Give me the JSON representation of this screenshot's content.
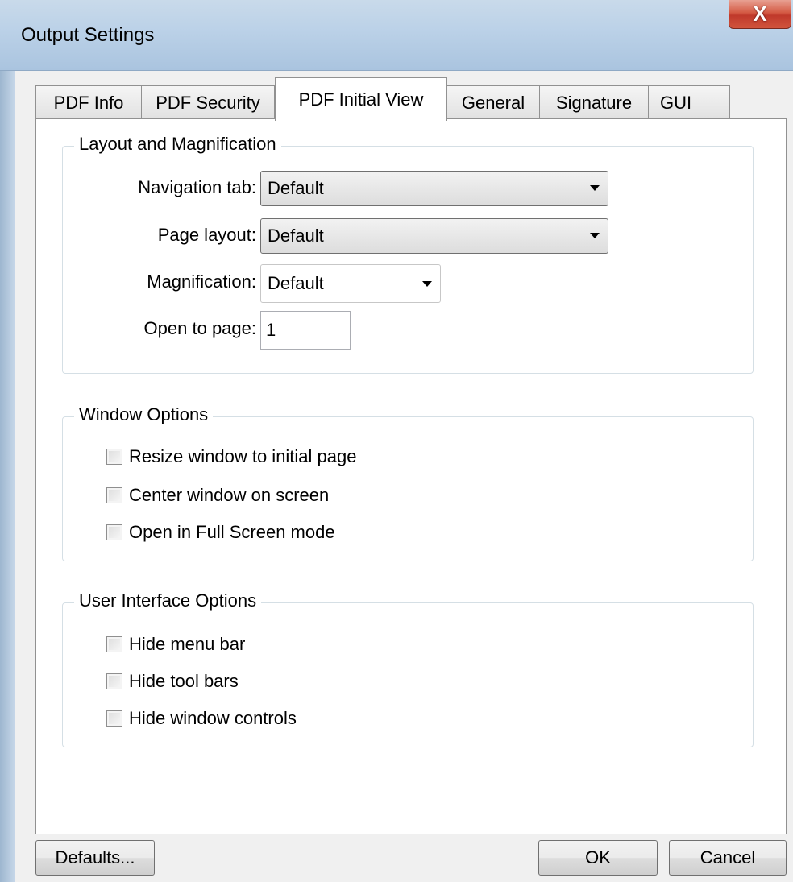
{
  "window": {
    "title": "Output Settings",
    "close_glyph": "X"
  },
  "tabs": [
    {
      "label": "PDF Info"
    },
    {
      "label": "PDF Security"
    },
    {
      "label": "PDF Initial View",
      "active": true
    },
    {
      "label": "General"
    },
    {
      "label": "Signature"
    },
    {
      "label": "GUI"
    }
  ],
  "layout_group": {
    "title": "Layout and Magnification",
    "navigation_tab": {
      "label": "Navigation tab:",
      "value": "Default"
    },
    "page_layout": {
      "label": "Page layout:",
      "value": "Default"
    },
    "magnification": {
      "label": "Magnification:",
      "value": "Default"
    },
    "open_to_page": {
      "label": "Open to page:",
      "value": "1"
    }
  },
  "window_group": {
    "title": "Window Options",
    "options": [
      {
        "label": "Resize window to initial page",
        "checked": false
      },
      {
        "label": "Center window on screen",
        "checked": false
      },
      {
        "label": "Open in Full Screen mode",
        "checked": false
      }
    ]
  },
  "ui_group": {
    "title": "User Interface Options",
    "options": [
      {
        "label": "Hide menu bar",
        "checked": false
      },
      {
        "label": "Hide tool bars",
        "checked": false
      },
      {
        "label": "Hide window controls",
        "checked": false
      }
    ]
  },
  "buttons": {
    "defaults": "Defaults...",
    "ok": "OK",
    "cancel": "Cancel"
  },
  "icons": {
    "close": "close-icon",
    "dropdown": "chevron-down-icon",
    "checkbox": "checkbox-icon"
  },
  "colors": {
    "titlebar": "#bcd2e8",
    "close_button": "#c0392b",
    "panel": "#ffffff",
    "dialog": "#f0f0f0"
  }
}
